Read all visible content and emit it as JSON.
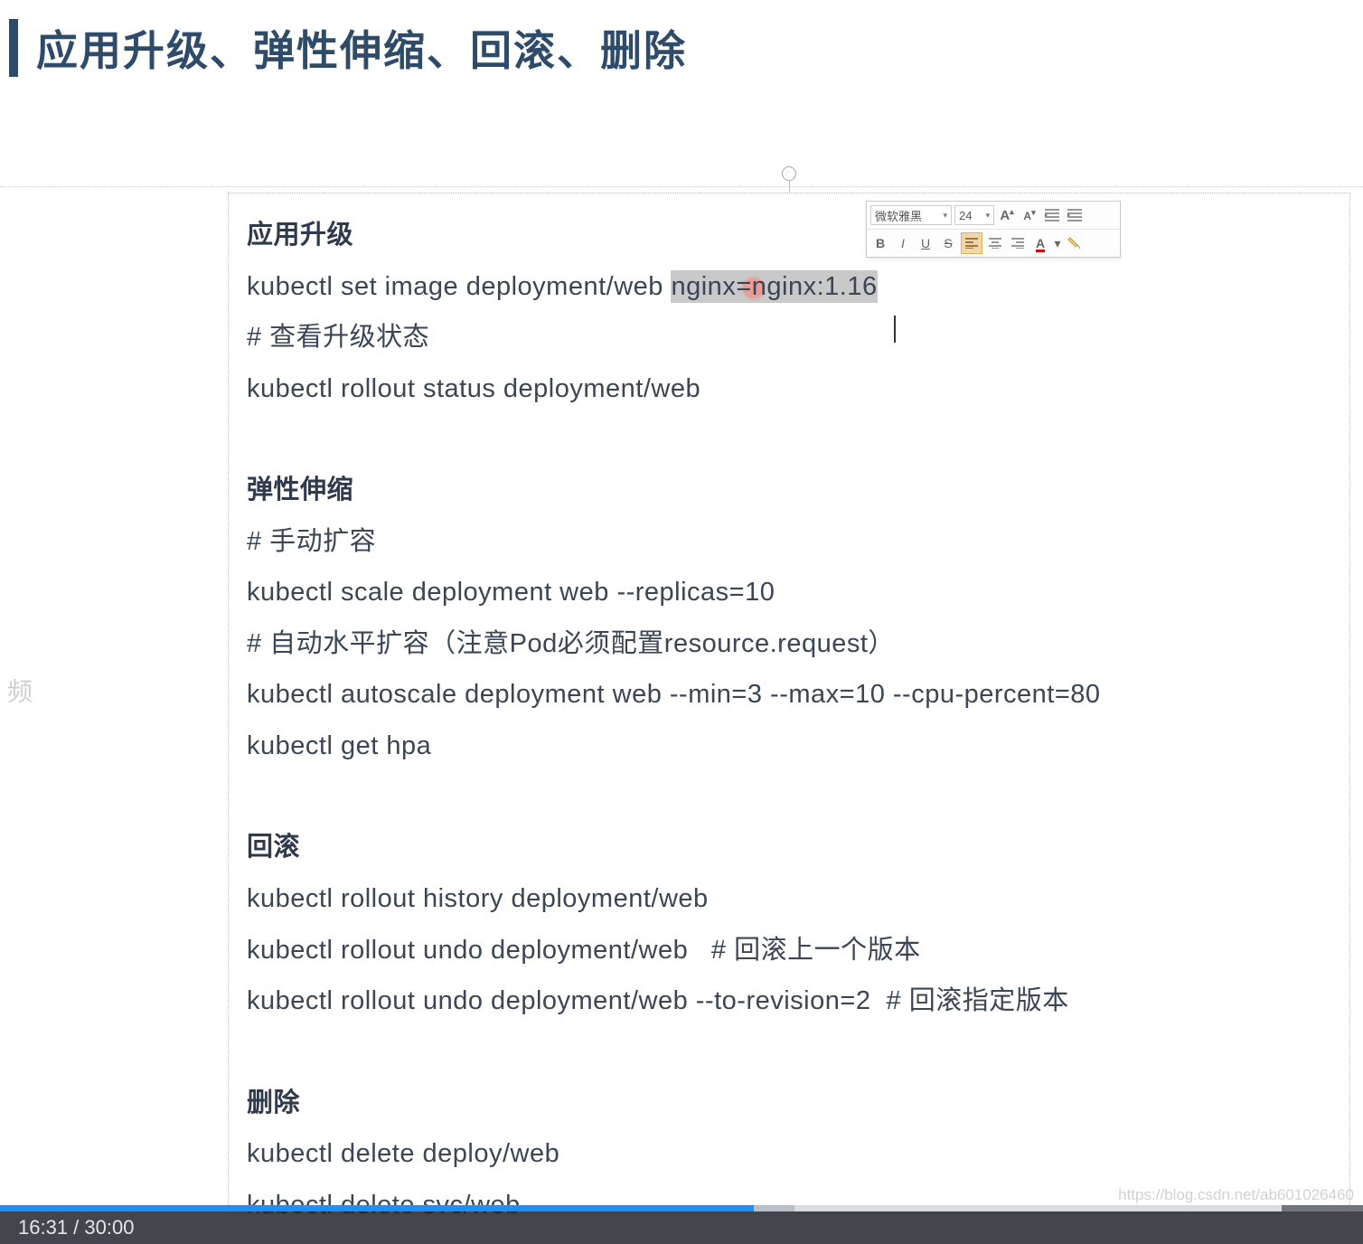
{
  "title": "应用升级、弹性伸缩、回滚、删除",
  "toolbar": {
    "font_name": "微软雅黑",
    "font_size": "24"
  },
  "slide": {
    "sections": [
      {
        "heading": "应用升级",
        "lines": [
          {
            "pre": "kubectl set image deployment/web ",
            "sel": "nginx=nginx:1.16",
            "post": ""
          },
          "# 查看升级状态",
          "kubectl rollout status deployment/web"
        ]
      },
      {
        "heading": "弹性伸缩",
        "lines": [
          "# 手动扩容",
          "kubectl scale deployment web --replicas=10",
          "# 自动水平扩容（注意Pod必须配置resource.request）",
          "kubectl autoscale deployment web --min=3 --max=10 --cpu-percent=80",
          "kubectl get hpa"
        ]
      },
      {
        "heading": "回滚",
        "lines": [
          "kubectl rollout history deployment/web",
          "kubectl rollout undo deployment/web   # 回滚上一个版本",
          "kubectl rollout undo deployment/web --to-revision=2  # 回滚指定版本"
        ]
      },
      {
        "heading": "删除",
        "lines": [
          "kubectl delete deploy/web",
          "kubectl delete svc/web"
        ]
      }
    ]
  },
  "edge_label": "频",
  "video": {
    "current": "16:31",
    "total": "30:00"
  },
  "watermark": "https://blog.csdn.net/ab601026460"
}
